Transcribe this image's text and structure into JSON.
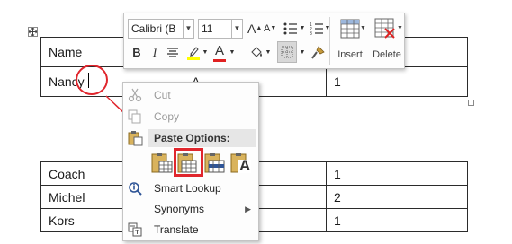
{
  "top_table": {
    "rows": [
      [
        "Name",
        "",
        ""
      ],
      [
        "Nancy",
        "A",
        "1"
      ]
    ]
  },
  "bottom_table": {
    "rows": [
      [
        "Coach",
        "",
        "1"
      ],
      [
        "Michel",
        "",
        "2"
      ],
      [
        "Kors",
        "",
        "1"
      ]
    ]
  },
  "mini_toolbar": {
    "font_name": "Calibri (B",
    "font_size": "11",
    "grow_font": "A",
    "shrink_font": "A",
    "bold": "B",
    "italic": "I",
    "font_color_letter": "A",
    "insert_label": "Insert",
    "delete_label": "Delete"
  },
  "context_menu": {
    "cut": "Cut",
    "copy": "Copy",
    "paste_options_header": "Paste Options:",
    "paste_option_keep_text_letter": "A",
    "smart_lookup": "Smart Lookup",
    "synonyms": "Synonyms",
    "translate": "Translate"
  },
  "colors": {
    "annotation_red": "#e0262d",
    "highlight_yellow": "#ffff00",
    "font_color_red": "#e02020",
    "paste_icon_blue": "#2f5597"
  }
}
